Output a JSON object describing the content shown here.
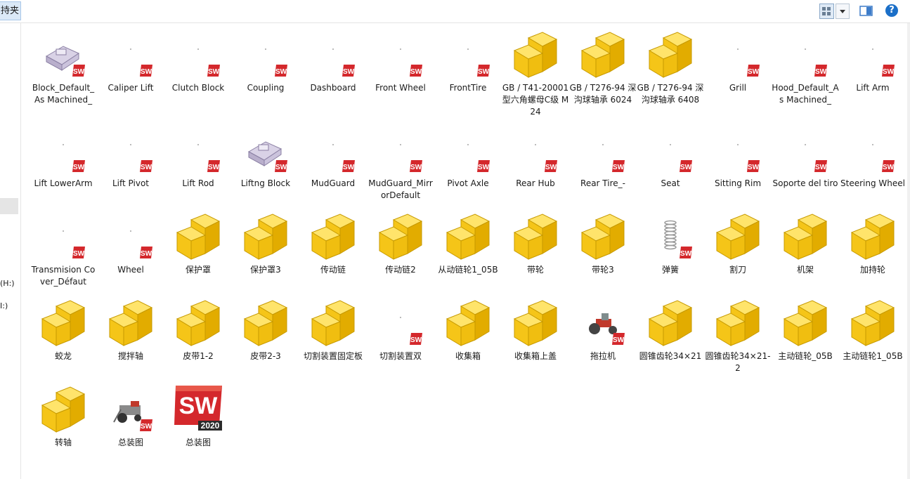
{
  "toolbar": {
    "favorites_fragment": "持夹",
    "help_label": "?"
  },
  "nav": {
    "drive_fragment_1": "(H:)",
    "drive_fragment_2": "I:)"
  },
  "colors": {
    "folder": "#f5c518",
    "folder_edge": "#c79a00",
    "sw_red": "#d4282c",
    "selection": "#dbe9f7"
  },
  "files": [
    {
      "label": "Block_Default_As Machined_",
      "icon": "sw-part-thumbnail",
      "badge": true
    },
    {
      "label": "Caliper Lift",
      "icon": "sw-blank",
      "badge": true
    },
    {
      "label": "Clutch Block",
      "icon": "sw-blank",
      "badge": true
    },
    {
      "label": "Coupling",
      "icon": "sw-blank",
      "badge": true
    },
    {
      "label": "Dashboard",
      "icon": "sw-blank",
      "badge": true
    },
    {
      "label": "Front Wheel",
      "icon": "sw-blank",
      "badge": true
    },
    {
      "label": "FrontTire",
      "icon": "sw-blank",
      "badge": true
    },
    {
      "label": "GB / T41-20001型六角螺母C级 M24",
      "icon": "part-block",
      "badge": false
    },
    {
      "label": "GB / T276-94 深沟球轴承 6024",
      "icon": "part-block",
      "badge": false
    },
    {
      "label": "GB / T276-94 深沟球轴承 6408",
      "icon": "part-block",
      "badge": false
    },
    {
      "label": "Grill",
      "icon": "sw-blank",
      "badge": true
    },
    {
      "label": "Hood_Default_As Machined_",
      "icon": "sw-blank",
      "badge": true
    },
    {
      "label": "Lift Arm",
      "icon": "sw-blank",
      "badge": true
    },
    {
      "label": "Lift LowerArm",
      "icon": "sw-blank",
      "badge": true
    },
    {
      "label": "Lift Pivot",
      "icon": "sw-blank",
      "badge": true
    },
    {
      "label": "Lift Rod",
      "icon": "sw-blank",
      "badge": true
    },
    {
      "label": "Liftng Block",
      "icon": "sw-part-thumbnail",
      "badge": true
    },
    {
      "label": "MudGuard",
      "icon": "sw-blank",
      "badge": true
    },
    {
      "label": "MudGuard_MirrorDefault",
      "icon": "sw-blank",
      "badge": true
    },
    {
      "label": "Pivot Axle",
      "icon": "sw-blank",
      "badge": true
    },
    {
      "label": "Rear Hub",
      "icon": "sw-blank",
      "badge": true
    },
    {
      "label": "Rear Tire_-",
      "icon": "sw-blank",
      "badge": true
    },
    {
      "label": "Seat",
      "icon": "sw-blank",
      "badge": true
    },
    {
      "label": "Sitting Rim",
      "icon": "sw-blank",
      "badge": true
    },
    {
      "label": "Soporte del tiro",
      "icon": "sw-blank",
      "badge": true
    },
    {
      "label": "Steering Wheel",
      "icon": "sw-blank",
      "badge": true
    },
    {
      "label": "Transmision Cover_Défaut",
      "icon": "sw-blank",
      "badge": true
    },
    {
      "label": "Wheel",
      "icon": "sw-blank",
      "badge": true
    },
    {
      "label": "保护罩",
      "icon": "part-block",
      "badge": false
    },
    {
      "label": "保护罩3",
      "icon": "part-block",
      "badge": false
    },
    {
      "label": "传动链",
      "icon": "part-block",
      "badge": false
    },
    {
      "label": "传动链2",
      "icon": "part-block",
      "badge": false
    },
    {
      "label": "从动链轮1_05B",
      "icon": "part-block",
      "badge": false
    },
    {
      "label": "带轮",
      "icon": "part-block",
      "badge": false
    },
    {
      "label": "带轮3",
      "icon": "part-block",
      "badge": false
    },
    {
      "label": "弹簧",
      "icon": "spring-thumbnail",
      "badge": true
    },
    {
      "label": "割刀",
      "icon": "part-block",
      "badge": false
    },
    {
      "label": "机架",
      "icon": "part-block",
      "badge": false
    },
    {
      "label": "加持轮",
      "icon": "part-block",
      "badge": false
    },
    {
      "label": "蛟龙",
      "icon": "part-block",
      "badge": false
    },
    {
      "label": "搅拌轴",
      "icon": "part-block",
      "badge": false
    },
    {
      "label": "皮带1-2",
      "icon": "part-block",
      "badge": false
    },
    {
      "label": "皮带2-3",
      "icon": "part-block",
      "badge": false
    },
    {
      "label": "切割装置固定板",
      "icon": "part-block",
      "badge": false
    },
    {
      "label": "切割装置双",
      "icon": "sw-blank",
      "badge": true
    },
    {
      "label": "收集箱",
      "icon": "part-block",
      "badge": false
    },
    {
      "label": "收集箱上盖",
      "icon": "part-block",
      "badge": false
    },
    {
      "label": "拖拉机",
      "icon": "tractor-thumbnail",
      "badge": true
    },
    {
      "label": "圆锥齿轮34×21",
      "icon": "part-block",
      "badge": false
    },
    {
      "label": "圆锥齿轮34×21-2",
      "icon": "part-block",
      "badge": false
    },
    {
      "label": "主动链轮_05B",
      "icon": "part-block",
      "badge": false
    },
    {
      "label": "主动链轮1_05B",
      "icon": "part-block",
      "badge": false
    },
    {
      "label": "转轴",
      "icon": "part-block",
      "badge": false
    },
    {
      "label": "总装图",
      "icon": "assembly-thumbnail",
      "badge": true
    },
    {
      "label": "总装图",
      "icon": "sw2020-app",
      "badge": false
    }
  ],
  "sw2020_badge_text": "2020",
  "sw_letters": "SW"
}
